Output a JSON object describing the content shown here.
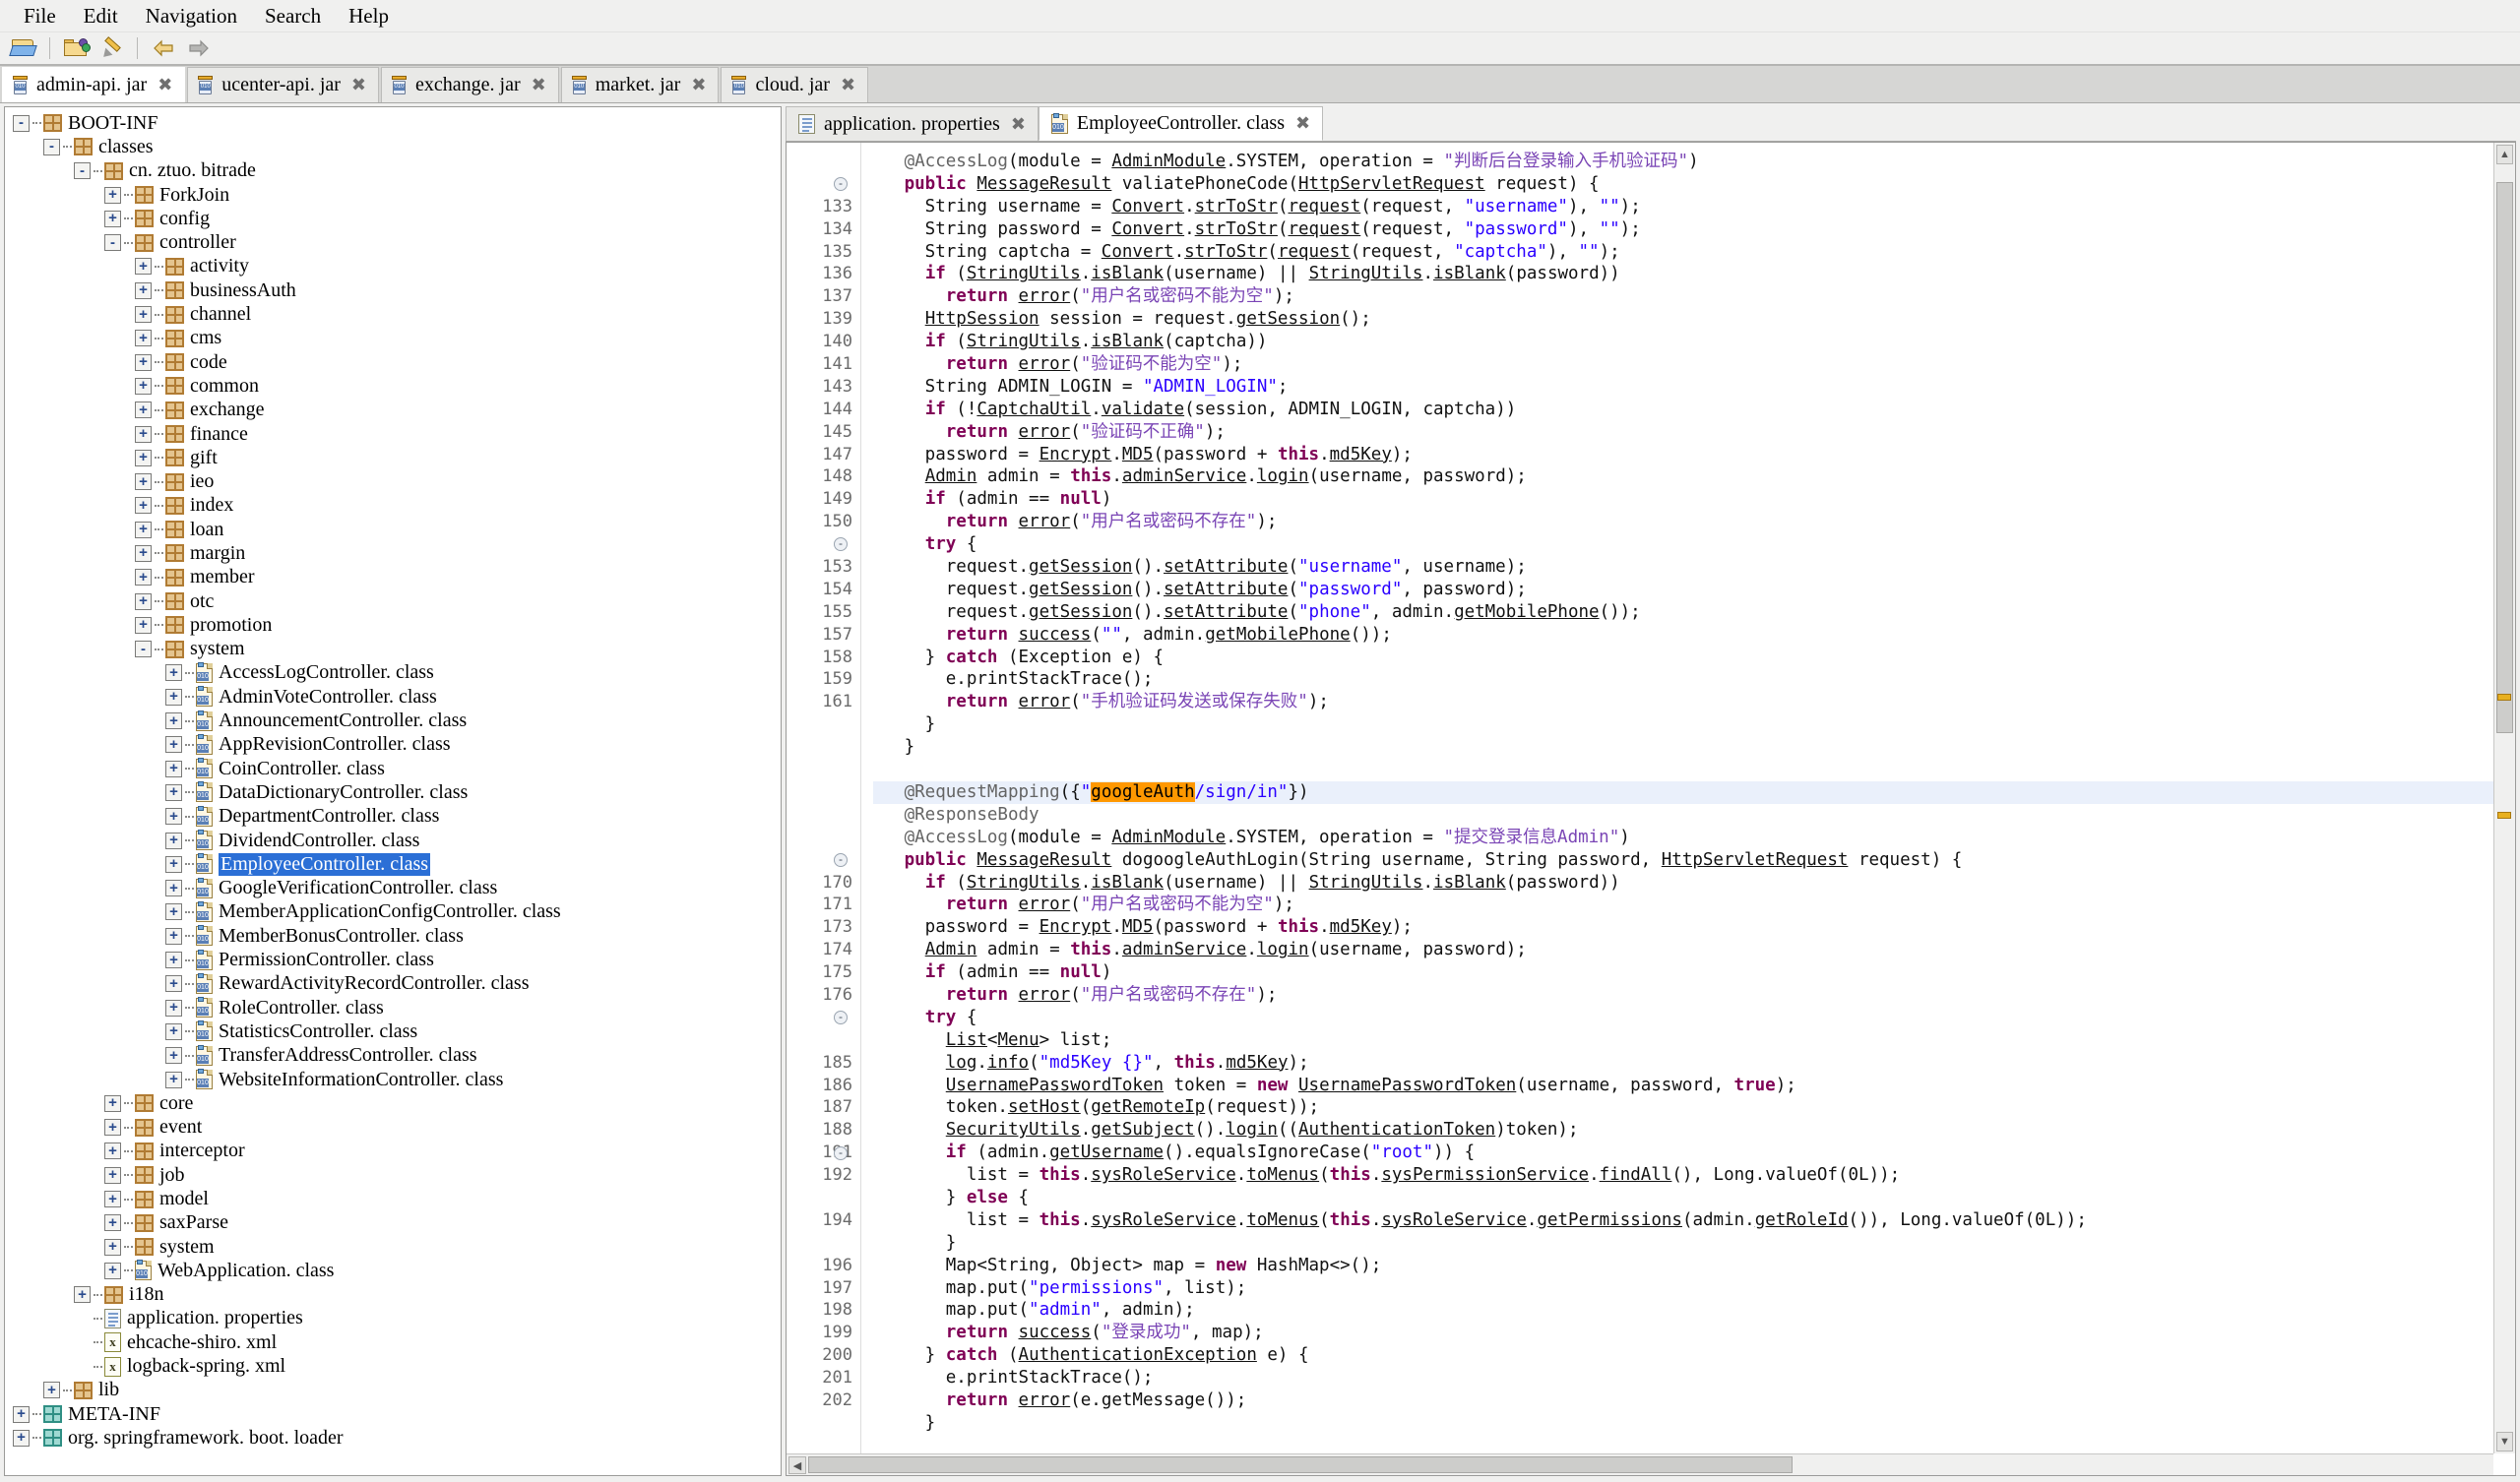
{
  "menubar": {
    "items": [
      "File",
      "Edit",
      "Navigation",
      "Search",
      "Help"
    ]
  },
  "toolbar": {
    "buttons": [
      {
        "name": "open-file",
        "icon": "folder-open-icon"
      },
      {
        "name": "open-type",
        "icon": "folder-search-icon"
      },
      {
        "name": "search",
        "icon": "pen-icon"
      },
      {
        "name": "back",
        "icon": "arrow-left-icon"
      },
      {
        "name": "forward",
        "icon": "arrow-right-icon"
      }
    ]
  },
  "jar_tabs": [
    {
      "label": "admin-api. jar",
      "active": true
    },
    {
      "label": "ucenter-api. jar",
      "active": false
    },
    {
      "label": "exchange. jar",
      "active": false
    },
    {
      "label": "market. jar",
      "active": false
    },
    {
      "label": "cloud. jar",
      "active": false
    }
  ],
  "tab_close_glyph": "✖",
  "tree": [
    {
      "depth": 0,
      "toggle": "-",
      "icon": "pkg",
      "label": "BOOT-INF"
    },
    {
      "depth": 1,
      "toggle": "-",
      "icon": "pkg",
      "label": "classes"
    },
    {
      "depth": 2,
      "toggle": "-",
      "icon": "pkg",
      "label": "cn. ztuo. bitrade"
    },
    {
      "depth": 3,
      "toggle": "+",
      "icon": "pkg",
      "label": "ForkJoin"
    },
    {
      "depth": 3,
      "toggle": "+",
      "icon": "pkg",
      "label": "config"
    },
    {
      "depth": 3,
      "toggle": "-",
      "icon": "pkg",
      "label": "controller"
    },
    {
      "depth": 4,
      "toggle": "+",
      "icon": "pkg",
      "label": "activity"
    },
    {
      "depth": 4,
      "toggle": "+",
      "icon": "pkg",
      "label": "businessAuth"
    },
    {
      "depth": 4,
      "toggle": "+",
      "icon": "pkg",
      "label": "channel"
    },
    {
      "depth": 4,
      "toggle": "+",
      "icon": "pkg",
      "label": "cms"
    },
    {
      "depth": 4,
      "toggle": "+",
      "icon": "pkg",
      "label": "code"
    },
    {
      "depth": 4,
      "toggle": "+",
      "icon": "pkg",
      "label": "common"
    },
    {
      "depth": 4,
      "toggle": "+",
      "icon": "pkg",
      "label": "exchange"
    },
    {
      "depth": 4,
      "toggle": "+",
      "icon": "pkg",
      "label": "finance"
    },
    {
      "depth": 4,
      "toggle": "+",
      "icon": "pkg",
      "label": "gift"
    },
    {
      "depth": 4,
      "toggle": "+",
      "icon": "pkg",
      "label": "ieo"
    },
    {
      "depth": 4,
      "toggle": "+",
      "icon": "pkg",
      "label": "index"
    },
    {
      "depth": 4,
      "toggle": "+",
      "icon": "pkg",
      "label": "loan"
    },
    {
      "depth": 4,
      "toggle": "+",
      "icon": "pkg",
      "label": "margin"
    },
    {
      "depth": 4,
      "toggle": "+",
      "icon": "pkg",
      "label": "member"
    },
    {
      "depth": 4,
      "toggle": "+",
      "icon": "pkg",
      "label": "otc"
    },
    {
      "depth": 4,
      "toggle": "+",
      "icon": "pkg",
      "label": "promotion"
    },
    {
      "depth": 4,
      "toggle": "-",
      "icon": "pkg",
      "label": "system"
    },
    {
      "depth": 5,
      "toggle": "+",
      "icon": "class",
      "label": "AccessLogController. class"
    },
    {
      "depth": 5,
      "toggle": "+",
      "icon": "class",
      "label": "AdminVoteController. class"
    },
    {
      "depth": 5,
      "toggle": "+",
      "icon": "class",
      "label": "AnnouncementController. class"
    },
    {
      "depth": 5,
      "toggle": "+",
      "icon": "class",
      "label": "AppRevisionController. class"
    },
    {
      "depth": 5,
      "toggle": "+",
      "icon": "class",
      "label": "CoinController. class"
    },
    {
      "depth": 5,
      "toggle": "+",
      "icon": "class",
      "label": "DataDictionaryController. class"
    },
    {
      "depth": 5,
      "toggle": "+",
      "icon": "class",
      "label": "DepartmentController. class"
    },
    {
      "depth": 5,
      "toggle": "+",
      "icon": "class",
      "label": "DividendController. class"
    },
    {
      "depth": 5,
      "toggle": "+",
      "icon": "class",
      "label": "EmployeeController. class",
      "selected": true
    },
    {
      "depth": 5,
      "toggle": "+",
      "icon": "class",
      "label": "GoogleVerificationController. class"
    },
    {
      "depth": 5,
      "toggle": "+",
      "icon": "class",
      "label": "MemberApplicationConfigController. class"
    },
    {
      "depth": 5,
      "toggle": "+",
      "icon": "class",
      "label": "MemberBonusController. class"
    },
    {
      "depth": 5,
      "toggle": "+",
      "icon": "class",
      "label": "PermissionController. class"
    },
    {
      "depth": 5,
      "toggle": "+",
      "icon": "class",
      "label": "RewardActivityRecordController. class"
    },
    {
      "depth": 5,
      "toggle": "+",
      "icon": "class",
      "label": "RoleController. class"
    },
    {
      "depth": 5,
      "toggle": "+",
      "icon": "class",
      "label": "StatisticsController. class"
    },
    {
      "depth": 5,
      "toggle": "+",
      "icon": "class",
      "label": "TransferAddressController. class"
    },
    {
      "depth": 5,
      "toggle": "+",
      "icon": "class",
      "label": "WebsiteInformationController. class"
    },
    {
      "depth": 3,
      "toggle": "+",
      "icon": "pkg",
      "label": "core"
    },
    {
      "depth": 3,
      "toggle": "+",
      "icon": "pkg",
      "label": "event"
    },
    {
      "depth": 3,
      "toggle": "+",
      "icon": "pkg",
      "label": "interceptor"
    },
    {
      "depth": 3,
      "toggle": "+",
      "icon": "pkg",
      "label": "job"
    },
    {
      "depth": 3,
      "toggle": "+",
      "icon": "pkg",
      "label": "model"
    },
    {
      "depth": 3,
      "toggle": "+",
      "icon": "pkg",
      "label": "saxParse"
    },
    {
      "depth": 3,
      "toggle": "+",
      "icon": "pkg",
      "label": "system"
    },
    {
      "depth": 3,
      "toggle": "+",
      "icon": "class",
      "label": "WebApplication. class"
    },
    {
      "depth": 2,
      "toggle": "+",
      "icon": "pkg",
      "label": "i18n"
    },
    {
      "depth": 2,
      "toggle": "",
      "icon": "prop",
      "label": "application. properties"
    },
    {
      "depth": 2,
      "toggle": "",
      "icon": "xml",
      "label": "ehcache-shiro. xml"
    },
    {
      "depth": 2,
      "toggle": "",
      "icon": "xml",
      "label": "logback-spring. xml"
    },
    {
      "depth": 1,
      "toggle": "+",
      "icon": "pkg",
      "label": "lib"
    },
    {
      "depth": 0,
      "toggle": "+",
      "icon": "pkg-teal",
      "label": "META-INF"
    },
    {
      "depth": 0,
      "toggle": "+",
      "icon": "pkg-teal",
      "label": "org. springframework. boot. loader"
    }
  ],
  "file_tabs": [
    {
      "label": "application. properties",
      "icon": "properties-icon",
      "active": false
    },
    {
      "label": "EmployeeController. class",
      "icon": "class-icon",
      "active": true
    }
  ],
  "editor": {
    "search_hit": "googleAuth",
    "lines": [
      {
        "num": "",
        "fold": "",
        "html": "   <span class=\"ann\">@AccessLog</span>(module = <span class=\"lnk\">AdminModule</span>.SYSTEM, operation = <span class=\"cstr\">\"判断后台登录输入手机验证码\"</span>)"
      },
      {
        "num": "",
        "fold": "-",
        "html": "   <span class=\"kw\">public</span> <span class=\"lnk\">MessageResult</span> valiatePhoneCode(<span class=\"lnk\">HttpServletRequest</span> request) {"
      },
      {
        "num": "133",
        "fold": "",
        "html": "     String username = <span class=\"lnk\">Convert</span>.<span class=\"lnk\">strToStr</span>(<span class=\"lnk\">request</span>(request, <span class=\"str\">\"username\"</span>), <span class=\"str\">\"\"</span>);"
      },
      {
        "num": "134",
        "fold": "",
        "html": "     String password = <span class=\"lnk\">Convert</span>.<span class=\"lnk\">strToStr</span>(<span class=\"lnk\">request</span>(request, <span class=\"str\">\"password\"</span>), <span class=\"str\">\"\"</span>);"
      },
      {
        "num": "135",
        "fold": "",
        "html": "     String captcha = <span class=\"lnk\">Convert</span>.<span class=\"lnk\">strToStr</span>(<span class=\"lnk\">request</span>(request, <span class=\"str\">\"captcha\"</span>), <span class=\"str\">\"\"</span>);"
      },
      {
        "num": "136",
        "fold": "",
        "html": "     <span class=\"kw\">if</span> (<span class=\"lnk\">StringUtils</span>.<span class=\"lnk\">isBlank</span>(username) || <span class=\"lnk\">StringUtils</span>.<span class=\"lnk\">isBlank</span>(password))"
      },
      {
        "num": "137",
        "fold": "",
        "html": "       <span class=\"kw\">return</span> <span class=\"lnk\">error</span>(<span class=\"cstr\">\"用户名或密码不能为空\"</span>);"
      },
      {
        "num": "139",
        "fold": "",
        "html": "     <span class=\"lnk\">HttpSession</span> session = request.<span class=\"lnk\">getSession</span>();"
      },
      {
        "num": "140",
        "fold": "",
        "html": "     <span class=\"kw\">if</span> (<span class=\"lnk\">StringUtils</span>.<span class=\"lnk\">isBlank</span>(captcha))"
      },
      {
        "num": "141",
        "fold": "",
        "html": "       <span class=\"kw\">return</span> <span class=\"lnk\">error</span>(<span class=\"cstr\">\"验证码不能为空\"</span>);"
      },
      {
        "num": "143",
        "fold": "",
        "html": "     String ADMIN_LOGIN = <span class=\"str\">\"ADMIN_LOGIN\"</span>;"
      },
      {
        "num": "144",
        "fold": "",
        "html": "     <span class=\"kw\">if</span> (!<span class=\"lnk\">CaptchaUtil</span>.<span class=\"lnk\">validate</span>(session, ADMIN_LOGIN, captcha))"
      },
      {
        "num": "145",
        "fold": "",
        "html": "       <span class=\"kw\">return</span> <span class=\"lnk\">error</span>(<span class=\"cstr\">\"验证码不正确\"</span>);"
      },
      {
        "num": "147",
        "fold": "",
        "html": "     password = <span class=\"lnk\">Encrypt</span>.<span class=\"lnk\">MD5</span>(password + <span class=\"kw\">this</span>.<span class=\"lnk\">md5Key</span>);"
      },
      {
        "num": "148",
        "fold": "",
        "html": "     <span class=\"lnk\">Admin</span> admin = <span class=\"kw\">this</span>.<span class=\"lnk\">adminService</span>.<span class=\"lnk\">login</span>(username, password);"
      },
      {
        "num": "149",
        "fold": "",
        "html": "     <span class=\"kw\">if</span> (admin == <span class=\"kw\">null</span>)"
      },
      {
        "num": "150",
        "fold": "",
        "html": "       <span class=\"kw\">return</span> <span class=\"lnk\">error</span>(<span class=\"cstr\">\"用户名或密码不存在\"</span>);"
      },
      {
        "num": "",
        "fold": "-",
        "html": "     <span class=\"kw\">try</span> {"
      },
      {
        "num": "153",
        "fold": "",
        "html": "       request.<span class=\"lnk\">getSession</span>().<span class=\"lnk\">setAttribute</span>(<span class=\"str\">\"username\"</span>, username);"
      },
      {
        "num": "154",
        "fold": "",
        "html": "       request.<span class=\"lnk\">getSession</span>().<span class=\"lnk\">setAttribute</span>(<span class=\"str\">\"password\"</span>, password);"
      },
      {
        "num": "155",
        "fold": "",
        "html": "       request.<span class=\"lnk\">getSession</span>().<span class=\"lnk\">setAttribute</span>(<span class=\"str\">\"phone\"</span>, admin.<span class=\"lnk\">getMobilePhone</span>());"
      },
      {
        "num": "157",
        "fold": "",
        "html": "       <span class=\"kw\">return</span> <span class=\"lnk\">success</span>(<span class=\"str\">\"\"</span>, admin.<span class=\"lnk\">getMobilePhone</span>());"
      },
      {
        "num": "158",
        "fold": "",
        "html": "     } <span class=\"kw\">catch</span> (Exception e) {"
      },
      {
        "num": "159",
        "fold": "",
        "html": "       e.printStackTrace();"
      },
      {
        "num": "161",
        "fold": "",
        "html": "       <span class=\"kw\">return</span> <span class=\"lnk\">error</span>(<span class=\"cstr\">\"手机验证码发送或保存失败\"</span>);"
      },
      {
        "num": "",
        "fold": "",
        "html": "     }"
      },
      {
        "num": "",
        "fold": "",
        "html": "   }"
      },
      {
        "num": "",
        "fold": "",
        "html": ""
      },
      {
        "num": "",
        "fold": "",
        "hl": true,
        "html": "   <span class=\"ann\">@RequestMapping</span>({<span class=\"str\">\"</span><span class=\"hit\">googleAuth</span><span class=\"str\">/sign/in\"</span>})"
      },
      {
        "num": "",
        "fold": "",
        "html": "   <span class=\"ann\">@ResponseBody</span>"
      },
      {
        "num": "",
        "fold": "",
        "html": "   <span class=\"ann\">@AccessLog</span>(module = <span class=\"lnk\">AdminModule</span>.SYSTEM, operation = <span class=\"cstr\">\"提交登录信息Admin\"</span>)"
      },
      {
        "num": "",
        "fold": "-",
        "html": "   <span class=\"kw\">public</span> <span class=\"lnk\">MessageResult</span> dogoogleAuthLogin(String username, String password, <span class=\"lnk\">HttpServletRequest</span> request) {"
      },
      {
        "num": "170",
        "fold": "",
        "html": "     <span class=\"kw\">if</span> (<span class=\"lnk\">StringUtils</span>.<span class=\"lnk\">isBlank</span>(username) || <span class=\"lnk\">StringUtils</span>.<span class=\"lnk\">isBlank</span>(password))"
      },
      {
        "num": "171",
        "fold": "",
        "html": "       <span class=\"kw\">return</span> <span class=\"lnk\">error</span>(<span class=\"cstr\">\"用户名或密码不能为空\"</span>);"
      },
      {
        "num": "173",
        "fold": "",
        "html": "     password = <span class=\"lnk\">Encrypt</span>.<span class=\"lnk\">MD5</span>(password + <span class=\"kw\">this</span>.<span class=\"lnk\">md5Key</span>);"
      },
      {
        "num": "174",
        "fold": "",
        "html": "     <span class=\"lnk\">Admin</span> admin = <span class=\"kw\">this</span>.<span class=\"lnk\">adminService</span>.<span class=\"lnk\">login</span>(username, password);"
      },
      {
        "num": "175",
        "fold": "",
        "html": "     <span class=\"kw\">if</span> (admin == <span class=\"kw\">null</span>)"
      },
      {
        "num": "176",
        "fold": "",
        "html": "       <span class=\"kw\">return</span> <span class=\"lnk\">error</span>(<span class=\"cstr\">\"用户名或密码不存在\"</span>);"
      },
      {
        "num": "",
        "fold": "-",
        "html": "     <span class=\"kw\">try</span> {"
      },
      {
        "num": "",
        "fold": "",
        "html": "       <span class=\"lnk\">List</span>&lt;<span class=\"lnk\">Menu</span>&gt; list;"
      },
      {
        "num": "185",
        "fold": "",
        "html": "       <span class=\"lnk\">log</span>.<span class=\"lnk\">info</span>(<span class=\"str\">\"md5Key {}\"</span>, <span class=\"kw\">this</span>.<span class=\"lnk\">md5Key</span>);"
      },
      {
        "num": "186",
        "fold": "",
        "html": "       <span class=\"lnk\">UsernamePasswordToken</span> token = <span class=\"kw\">new</span> <span class=\"lnk\">UsernamePasswordToken</span>(username, password, <span class=\"kw\">true</span>);"
      },
      {
        "num": "187",
        "fold": "",
        "html": "       token.<span class=\"lnk\">setHost</span>(<span class=\"lnk\">getRemoteIp</span>(request));"
      },
      {
        "num": "188",
        "fold": "",
        "html": "       <span class=\"lnk\">SecurityUtils</span>.<span class=\"lnk\">getSubject</span>().<span class=\"lnk\">login</span>((<span class=\"lnk\">AuthenticationToken</span>)token);"
      },
      {
        "num": "191",
        "fold": "-",
        "html": "       <span class=\"kw\">if</span> (admin.<span class=\"lnk\">getUsername</span>().equalsIgnoreCase(<span class=\"str\">\"root\"</span>)) {"
      },
      {
        "num": "192",
        "fold": "",
        "html": "         list = <span class=\"kw\">this</span>.<span class=\"lnk\">sysRoleService</span>.<span class=\"lnk\">toMenus</span>(<span class=\"kw\">this</span>.<span class=\"lnk\">sysPermissionService</span>.<span class=\"lnk\">findAll</span>(), Long.valueOf(0L));"
      },
      {
        "num": "",
        "fold": "",
        "html": "       } <span class=\"kw\">else</span> {"
      },
      {
        "num": "194",
        "fold": "",
        "html": "         list = <span class=\"kw\">this</span>.<span class=\"lnk\">sysRoleService</span>.<span class=\"lnk\">toMenus</span>(<span class=\"kw\">this</span>.<span class=\"lnk\">sysRoleService</span>.<span class=\"lnk\">getPermissions</span>(admin.<span class=\"lnk\">getRoleId</span>()), Long.valueOf(0L));"
      },
      {
        "num": "",
        "fold": "",
        "html": "       }"
      },
      {
        "num": "196",
        "fold": "",
        "html": "       Map&lt;String, Object&gt; map = <span class=\"kw\">new</span> HashMap&lt;&gt;();"
      },
      {
        "num": "197",
        "fold": "",
        "html": "       map.put(<span class=\"str\">\"permissions\"</span>, list);"
      },
      {
        "num": "198",
        "fold": "",
        "html": "       map.put(<span class=\"str\">\"admin\"</span>, admin);"
      },
      {
        "num": "199",
        "fold": "",
        "html": "       <span class=\"kw\">return</span> <span class=\"lnk\">success</span>(<span class=\"cstr\">\"登录成功\"</span>, map);"
      },
      {
        "num": "200",
        "fold": "",
        "html": "     } <span class=\"kw\">catch</span> (<span class=\"lnk\">AuthenticationException</span> e) {"
      },
      {
        "num": "201",
        "fold": "",
        "html": "       e.printStackTrace();"
      },
      {
        "num": "202",
        "fold": "",
        "html": "       <span class=\"kw\">return</span> <span class=\"lnk\">error</span>(e.getMessage());"
      },
      {
        "num": "",
        "fold": "",
        "html": "     }"
      }
    ]
  },
  "scrollbar": {
    "up_glyph": "▲",
    "down_glyph": "▼",
    "left_glyph": "◀",
    "right_glyph": "▶"
  }
}
